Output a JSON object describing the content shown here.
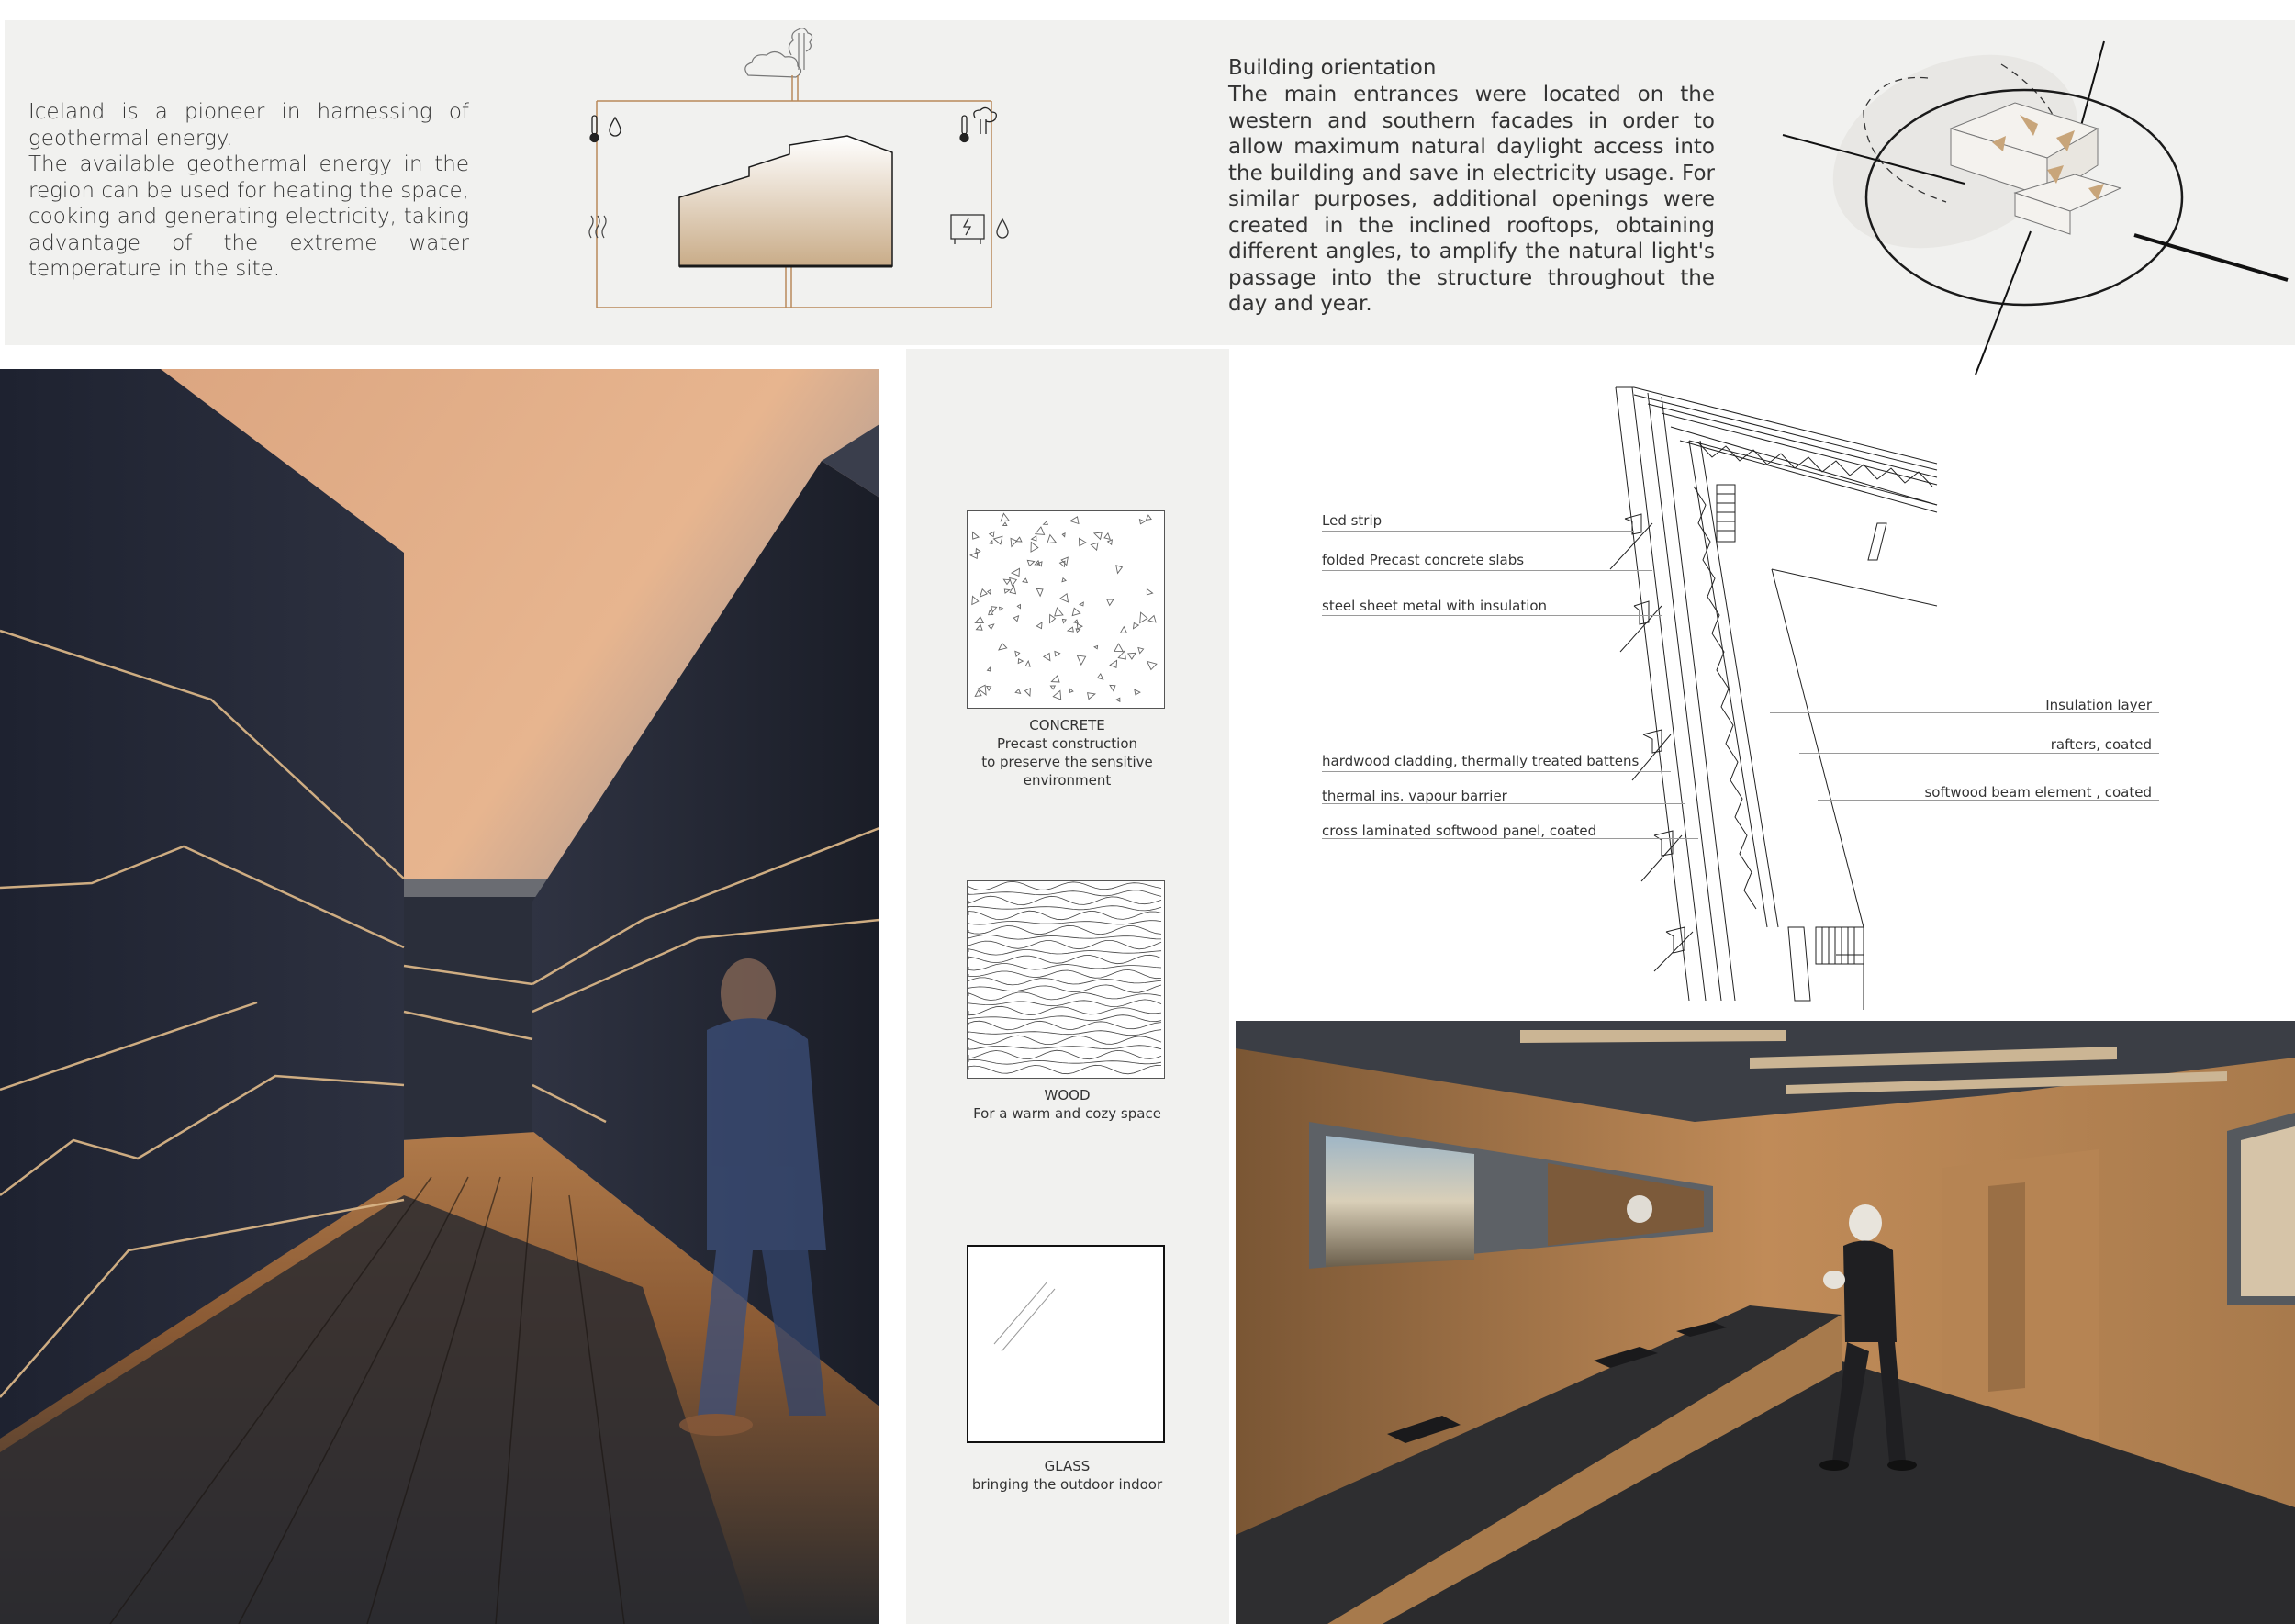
{
  "geothermal": {
    "text": "Iceland is a pioneer in harnessing of geothermal energy.\nThe available geothermal energy in the region can be used for heating the space, cooking and generating electricity, taking advantage of the extreme water temperature in the site."
  },
  "orientation": {
    "title": "Building orientation",
    "text": "The main entrances were located on the western and southern facades in order to allow maximum natural daylight access into the building and save in electricity usage. For similar purposes, additional openings were created in the inclined rooftops, obtaining different angles, to amplify the natural light's passage into the structure throughout the day and year."
  },
  "materials": [
    {
      "name": "CONCRETE",
      "line1": "Precast construction",
      "line2": "to preserve the sensitive environment"
    },
    {
      "name": "WOOD",
      "line1": "For a warm and cozy space",
      "line2": ""
    },
    {
      "name": "GLASS",
      "line1": "bringing the outdoor indoor",
      "line2": ""
    }
  ],
  "detail_labels": {
    "left": [
      "Led strip",
      "folded Precast concrete slabs",
      "steel sheet metal with insulation",
      "hardwood cladding, thermally treated battens",
      "thermal ins. vapour barrier",
      "cross laminated softwood panel, coated"
    ],
    "right": [
      "Insulation layer",
      "rafters, coated",
      "softwood beam element , coated"
    ]
  },
  "colors": {
    "panel": "#f1f1ef",
    "accent_copper": "#b9895a",
    "line_dark": "#1a1a1a"
  }
}
